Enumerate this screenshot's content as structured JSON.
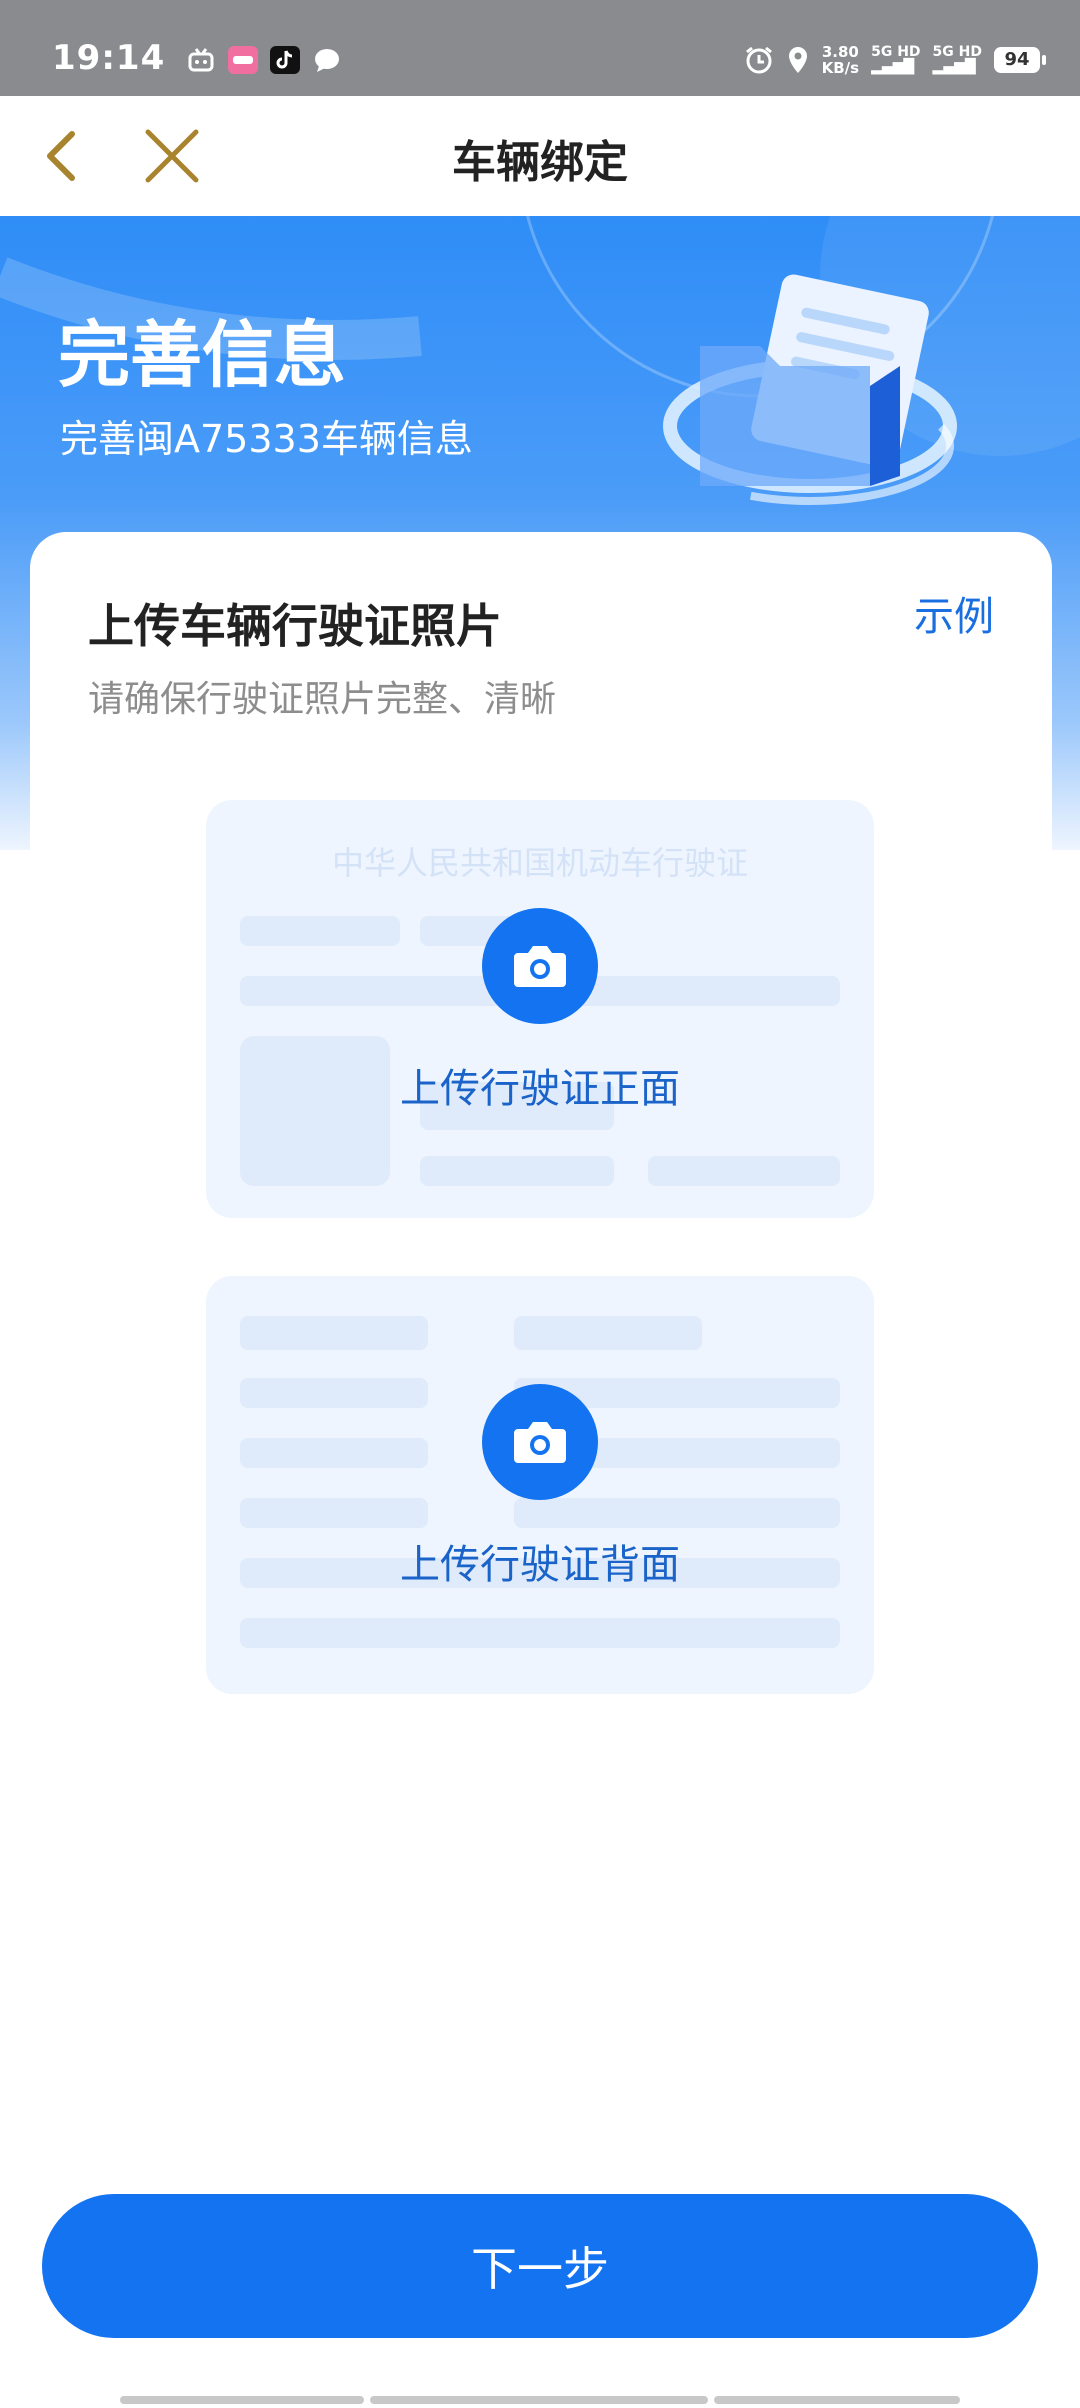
{
  "status_bar": {
    "time": "19:14",
    "net_speed_value": "3.80",
    "net_speed_unit": "KB/s",
    "sim1_label": "5G HD",
    "sim2_label": "5G HD",
    "battery_level": "94",
    "icons": [
      "bilibili-icon",
      "app-icon",
      "tiktok-icon",
      "message-icon",
      "alarm-icon",
      "location-icon"
    ]
  },
  "nav": {
    "title": "车辆绑定",
    "accent_color": "#a8842f"
  },
  "hero": {
    "title": "完善信息",
    "subtitle": "完善闽A75333车辆信息"
  },
  "card": {
    "title": "上传车辆行驶证照片",
    "example_link": "示例",
    "description": "请确保行驶证照片完整、清晰",
    "front": {
      "watermark": "中华人民共和国机动车行驶证",
      "label": "上传行驶证正面"
    },
    "back": {
      "label": "上传行驶证背面"
    }
  },
  "next_button": {
    "label": "下一步"
  },
  "colors": {
    "primary": "#1473f0",
    "hero_top": "#2f8df7",
    "upload_bg": "#eef5fe"
  }
}
